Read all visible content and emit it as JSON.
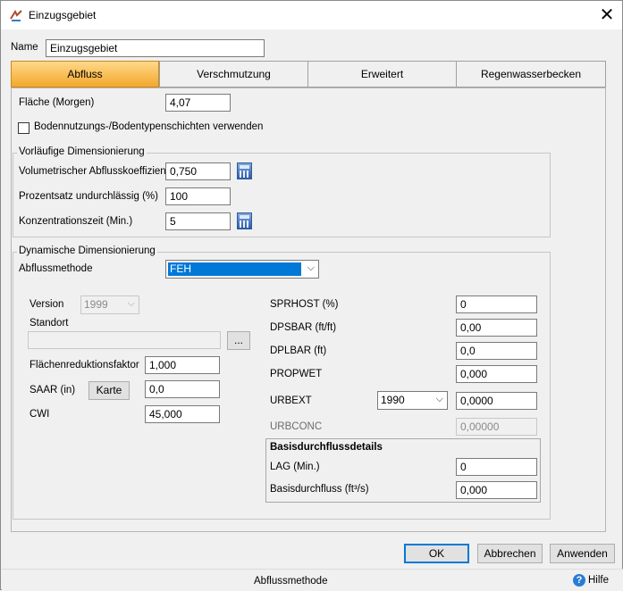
{
  "window": {
    "title": "Einzugsgebiet",
    "close_symbol": "✕"
  },
  "name_field": {
    "label": "Name",
    "value": "Einzugsgebiet"
  },
  "tabs": [
    {
      "label": "Abfluss",
      "active": true
    },
    {
      "label": "Verschmutzung",
      "active": false
    },
    {
      "label": "Erweitert",
      "active": false
    },
    {
      "label": "Regenwasserbecken",
      "active": false
    }
  ],
  "abfluss": {
    "flaeche_label": "Fläche (Morgen)",
    "flaeche_value": "4,07",
    "checkbox_label": "Bodennutzungs-/Bodentypenschichten verwenden",
    "checkbox_checked": false,
    "vorlaeufig": {
      "title": "Vorläufige Dimensionierung",
      "coef_label": "Volumetrischer Abflusskoeffizient",
      "coef_value": "0,750",
      "prozent_label": "Prozentsatz undurchlässig (%)",
      "prozent_value": "100",
      "konz_label": "Konzentrationszeit (Min.)",
      "konz_value": "5"
    },
    "dynamisch": {
      "title": "Dynamische Dimensionierung",
      "methode_label": "Abflussmethode",
      "methode_value": "FEH",
      "version_label": "Version",
      "version_value": "1999",
      "standort_label": "Standort",
      "standort_value": "",
      "browse_label": "...",
      "arf_label": "Flächenreduktionsfaktor",
      "arf_value": "1,000",
      "saar_label": "SAAR (in)",
      "karte_label": "Karte",
      "saar_value": "0,0",
      "cwi_label": "CWI",
      "cwi_value": "45,000",
      "sprhost_label": "SPRHOST (%)",
      "sprhost_value": "0",
      "dpsbar_label": "DPSBAR (ft/ft)",
      "dpsbar_value": "0,00",
      "dplbar_label": "DPLBAR (ft)",
      "dplbar_value": "0,0",
      "propwet_label": "PROPWET",
      "propwet_value": "0,000",
      "urbext_label": "URBEXT",
      "urbext_year": "1990",
      "urbext_value": "0,0000",
      "urbconc_label": "URBCONC",
      "urbconc_value": "0,00000",
      "basis": {
        "title": "Basisdurchflussdetails",
        "lag_label": "LAG (Min.)",
        "lag_value": "0",
        "flow_label": "Basisdurchfluss (ft³/s)",
        "flow_value": "0,000"
      }
    }
  },
  "buttons": {
    "ok": "OK",
    "cancel": "Abbrechen",
    "apply": "Anwenden"
  },
  "status": {
    "text": "Abflussmethode",
    "help": "Hilfe",
    "help_symbol": "?"
  },
  "colors": {
    "tab_active": "#f3a82c",
    "selection": "#0078d7",
    "calculator": "#2a5aa8"
  }
}
